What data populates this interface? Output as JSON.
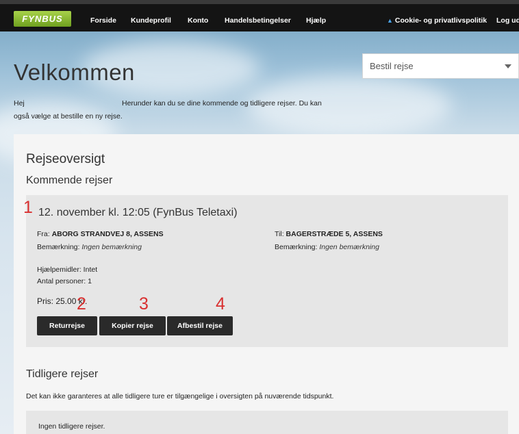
{
  "nav": {
    "logo": "FYNBUS",
    "items": [
      "Forside",
      "Kundeprofil",
      "Konto",
      "Handelsbetingelser",
      "Hjælp"
    ],
    "cookie": "Cookie- og privatlivspolitik",
    "logout": "Log ud"
  },
  "header": {
    "title": "Velkommen",
    "greeting": "Hej",
    "intro_line1": "Herunder kan du se dine kommende og tidligere rejser. Du kan",
    "intro_line2": "også vælge at bestille en ny rejse."
  },
  "order_select": {
    "value": "Bestil rejse"
  },
  "overview": {
    "title": "Rejseoversigt",
    "upcoming_title": "Kommende rejser",
    "trip": {
      "date": "12. november kl. 12:05 (FynBus Teletaxi)",
      "from_label": "Fra:",
      "from_value": "ABORG STRANDVEJ 8, ASSENS",
      "to_label": "Til:",
      "to_value": "BAGERSTRÆDE 5, ASSENS",
      "remark_label": "Bemærkning:",
      "remark_from": "Ingen bemærkning",
      "remark_to": "Ingen bemærkning",
      "aids": "Hjælpemidler: Intet",
      "persons": "Antal personer: 1",
      "price": "Pris: 25.00 kr."
    },
    "buttons": {
      "return": "Returrejse",
      "copy": "Kopier rejse",
      "cancel": "Afbestil rejse"
    },
    "annotations": [
      "1",
      "2",
      "3",
      "4"
    ],
    "previous_title": "Tidligere rejser",
    "previous_note": "Det kan ikke garanteres at alle tidligere ture er tilgængelige i oversigten på nuværende tidspunkt.",
    "previous_empty": "Ingen tidligere rejser."
  }
}
